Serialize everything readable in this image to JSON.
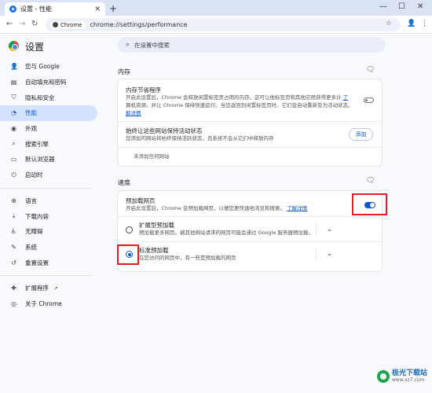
{
  "browser": {
    "tab_title": "设置 - 性能",
    "tab_close": "✕",
    "new_tab": "+",
    "win_min": "—",
    "win_max": "☐",
    "win_close": "✕",
    "chip_label": "Chrome",
    "url": "chrome://settings/performance"
  },
  "header": {
    "app_title": "设置",
    "search_placeholder": "在设置中搜索"
  },
  "sidebar": {
    "items": [
      {
        "label": "您与 Google",
        "icon": "person-icon",
        "glyph": "👤"
      },
      {
        "label": "自动填充和密码",
        "icon": "autofill-icon",
        "glyph": "▤"
      },
      {
        "label": "隐私和安全",
        "icon": "shield-icon",
        "glyph": "⛉"
      },
      {
        "label": "性能",
        "icon": "speed-icon",
        "glyph": "◔",
        "active": true
      },
      {
        "label": "外观",
        "icon": "palette-icon",
        "glyph": "◉"
      },
      {
        "label": "搜索引擎",
        "icon": "search-icon",
        "glyph": "⌕"
      },
      {
        "label": "默认浏览器",
        "icon": "browser-icon",
        "glyph": "▭"
      },
      {
        "label": "启动时",
        "icon": "power-icon",
        "glyph": "⏻"
      }
    ],
    "items2": [
      {
        "label": "语言",
        "icon": "globe-icon",
        "glyph": "⊕"
      },
      {
        "label": "下载内容",
        "icon": "download-icon",
        "glyph": "⤓"
      },
      {
        "label": "无障碍",
        "icon": "accessibility-icon",
        "glyph": "♿"
      },
      {
        "label": "系统",
        "icon": "wrench-icon",
        "glyph": "✎"
      },
      {
        "label": "重置设置",
        "icon": "reset-icon",
        "glyph": "↺"
      }
    ],
    "items3": [
      {
        "label": "扩展程序",
        "icon": "extension-icon",
        "glyph": "✚"
      },
      {
        "label": "关于 Chrome",
        "icon": "chrome-icon",
        "glyph": "◎"
      }
    ]
  },
  "memory": {
    "section_title": "内存",
    "saver_title": "内存节省程序",
    "saver_desc_1": "开启此设置后，Chrome 会释放闲置标签页占用的内存。这可让他标签页和其他应用获得更多计",
    "saver_desc_2": "算机资源，并让 Chrome 保持快速运行。当您返回到闲置标签页时，它们会自动重新变为活动状态。",
    "saver_link_1": "了",
    "saver_link_2": "解详情",
    "saver_enabled": false,
    "keep_title": "始终让这些网站保持活动状态",
    "keep_desc": "您添加的网站将始终保持活跃状态，且系统不会从它们中释放内存",
    "add_button": "添加",
    "no_sites": "未添加任何网站"
  },
  "speed": {
    "section_title": "速度",
    "preload_title": "预加载网页",
    "preload_desc": "开启此设置后，Chrome 会预加载网页，以便您更快速地浏览和搜索。",
    "preload_link": "了解详情",
    "preload_enabled": true,
    "options": [
      {
        "title": "扩展型预加载",
        "desc": "预加载更多网页。被其他网站请求的网页可能会通过 Google 服务器预加载。",
        "selected": false
      },
      {
        "title": "标准预加载",
        "desc": "在您访问的网页中，有一些是预加载的网页",
        "selected": true
      }
    ]
  },
  "watermark": {
    "name": "极光下载站",
    "url": "www.xz7.com"
  }
}
